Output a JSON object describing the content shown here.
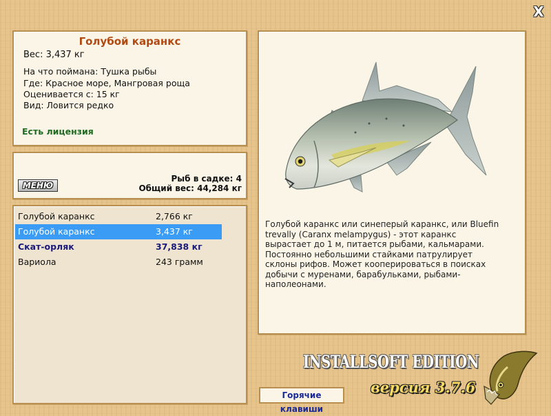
{
  "window": {
    "close_glyph": "X"
  },
  "info": {
    "title": "Голубой каранкс",
    "weight": "Вес: 3,437 кг",
    "caught_with": "На что поймана: Тушка рыбы",
    "location": "Где: Красное море, Мангровая роща",
    "rated_from": "Оценивается с: 15 кг",
    "species": "Вид: Ловится редко",
    "license": "Есть лицензия"
  },
  "keep": {
    "menu_label": "МЕНЮ",
    "fish_count": "Рыб в садке: 4",
    "total_weight": "Общий вес: 44,284 кг"
  },
  "catch_list": [
    {
      "name": "Голубой каранкс",
      "weight": "2,766 кг",
      "selected": false,
      "bold": false
    },
    {
      "name": "Голубой каранкс",
      "weight": "3,437 кг",
      "selected": true,
      "bold": false
    },
    {
      "name": "Скат-орляк",
      "weight": "37,838 кг",
      "selected": false,
      "bold": true
    },
    {
      "name": "Вариола",
      "weight": "243 грамм",
      "selected": false,
      "bold": false
    }
  ],
  "description": "Голубой каранкс или синеперый каранкс, или Bluefin trevally (Caranx melampygus) - этот каранкс вырастает до 1 м, питается рыбами, кальмарами. Постоянно небольшими стайками патрулирует склоны рифов. Может кооперироваться в поисках добычи с муренами, барабульками, рыбами-наполеонами.",
  "brand": {
    "title": "INSTALLSOFT EDITION",
    "version": "версия 3.7.6"
  },
  "hotkeys_label": "Горячие клавиши",
  "icons": [
    "close-icon",
    "fish-image",
    "pike-logo-icon"
  ],
  "colors": {
    "title": "#b24a12",
    "license": "#1f6b22",
    "selection": "#3b9cf5",
    "version": "#f7d860",
    "link": "#1a2a9a"
  }
}
